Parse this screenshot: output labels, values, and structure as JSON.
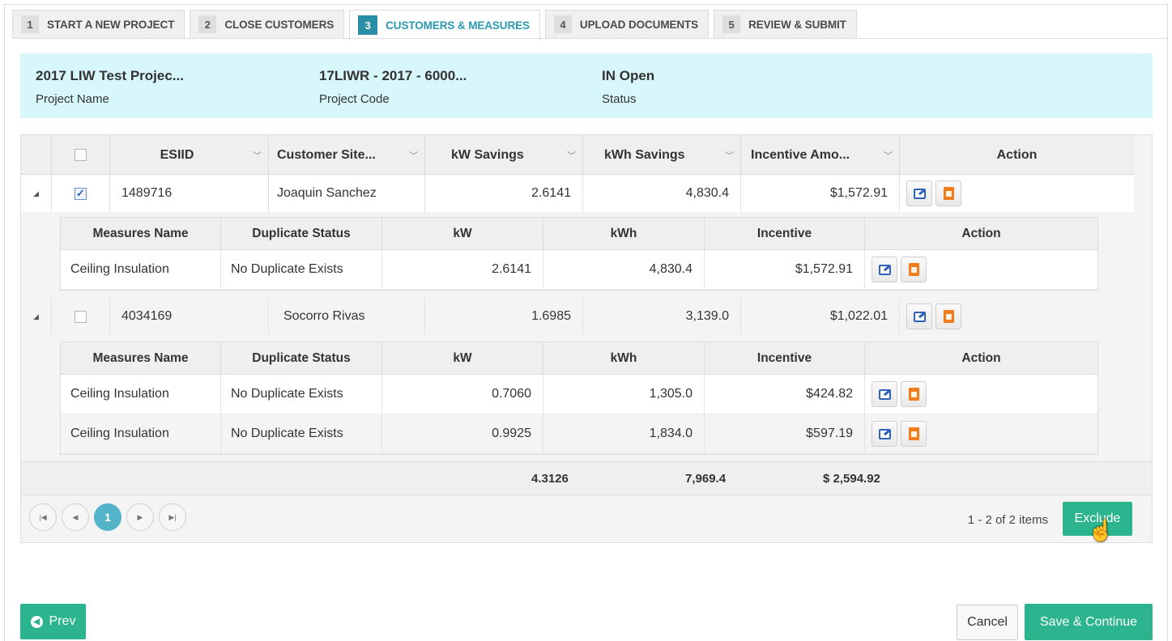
{
  "tabs": [
    {
      "num": "1",
      "label": "START A NEW PROJECT"
    },
    {
      "num": "2",
      "label": "CLOSE CUSTOMERS"
    },
    {
      "num": "3",
      "label": "CUSTOMERS & MEASURES"
    },
    {
      "num": "4",
      "label": "UPLOAD DOCUMENTS"
    },
    {
      "num": "5",
      "label": "REVIEW & SUBMIT"
    }
  ],
  "project": {
    "name_value": "2017 LIW Test Projec...",
    "name_label": "Project Name",
    "code_value": "17LIWR - 2017 - 6000...",
    "code_label": "Project Code",
    "status_value": "IN Open",
    "status_label": "Status"
  },
  "grid": {
    "headers": [
      "ESIID",
      "Customer Site...",
      "kW Savings",
      "kWh Savings",
      "Incentive Amo...",
      "Action"
    ],
    "rows": [
      {
        "checked": true,
        "esiid": "1489716",
        "customer": "Joaquin Sanchez",
        "kw": "2.6141",
        "kwh": "4,830.4",
        "incentive": "$1,572.91",
        "measures": [
          {
            "name": "Ceiling Insulation",
            "dup": "No Duplicate Exists",
            "kw": "2.6141",
            "kwh": "4,830.4",
            "incentive": "$1,572.91"
          }
        ]
      },
      {
        "checked": false,
        "esiid": "4034169",
        "customer": "Socorro Rivas",
        "kw": "1.6985",
        "kwh": "3,139.0",
        "incentive": "$1,022.01",
        "measures": [
          {
            "name": "Ceiling Insulation",
            "dup": "No Duplicate Exists",
            "kw": "0.7060",
            "kwh": "1,305.0",
            "incentive": "$424.82"
          },
          {
            "name": "Ceiling Insulation",
            "dup": "No Duplicate Exists",
            "kw": "0.9925",
            "kwh": "1,834.0",
            "incentive": "$597.19"
          }
        ]
      }
    ],
    "detail_headers": [
      "Measures Name",
      "Duplicate Status",
      "kW",
      "kWh",
      "Incentive",
      "Action"
    ],
    "totals": {
      "kw": "4.3126",
      "kwh": "7,969.4",
      "incentive": "$ 2,594.92"
    }
  },
  "pager": {
    "current": "1",
    "items_text": "1 - 2 of 2 items"
  },
  "buttons": {
    "exclude": "Exclude",
    "prev": "Prev",
    "cancel": "Cancel",
    "save_continue": "Save & Continue"
  },
  "icons": {
    "edit": "edit-icon",
    "document": "document-icon",
    "expander": "collapse-icon",
    "pager_first": "first-page-icon",
    "pager_prev": "prev-page-icon",
    "pager_next": "next-page-icon",
    "pager_last": "last-page-icon",
    "prev_button": "arrow-left-circle-icon",
    "cursor": "hand-pointer-icon"
  },
  "colors": {
    "accent_teal": "#2bb48d",
    "active_tab": "#2a8ea6",
    "info_bg": "#d8f7fb",
    "pager_current": "#53b3c7",
    "edit_icon": "#2f62b8",
    "document_icon": "#f07c1c"
  }
}
